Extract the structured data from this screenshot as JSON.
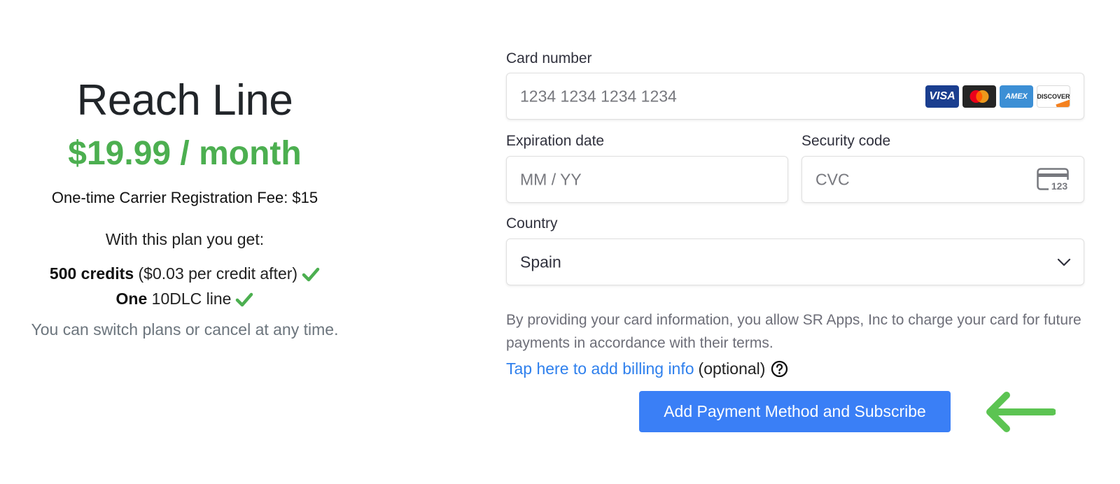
{
  "plan": {
    "title": "Reach Line",
    "price": "$19.99 / month",
    "fee": "One-time Carrier Registration Fee: $15",
    "intro": "With this plan you get:",
    "features": [
      {
        "bold": "500 credits",
        "rest": " ($0.03 per credit after)"
      },
      {
        "bold": "One",
        "rest": " 10DLC line"
      }
    ],
    "note": "You can switch plans or cancel at any time."
  },
  "form": {
    "card_number": {
      "label": "Card number",
      "placeholder": "1234 1234 1234 1234"
    },
    "card_brands": [
      "VISA",
      "mastercard",
      "AMEX",
      "DISCOVER"
    ],
    "expiration": {
      "label": "Expiration date",
      "placeholder": "MM / YY"
    },
    "security_code": {
      "label": "Security code",
      "placeholder": "CVC",
      "icon_text": "123"
    },
    "country": {
      "label": "Country",
      "value": "Spain"
    },
    "legal": "By providing your card information, you allow SR Apps, Inc to charge your card for future payments in accordance with their terms.",
    "billing_link": "Tap here to add billing info",
    "billing_optional": "(optional)",
    "submit_label": "Add Payment Method and Subscribe"
  },
  "colors": {
    "price_green": "#4caf50",
    "check_green": "#4caf50",
    "button_blue": "#3a7ff6",
    "link_blue": "#2f80ed",
    "arrow_green": "#5cc452"
  },
  "icons": {
    "check": "check-icon",
    "chevron": "chevron-down-icon",
    "help": "question-circle-icon",
    "cvc": "card-cvc-icon",
    "arrow": "arrow-left-icon"
  }
}
